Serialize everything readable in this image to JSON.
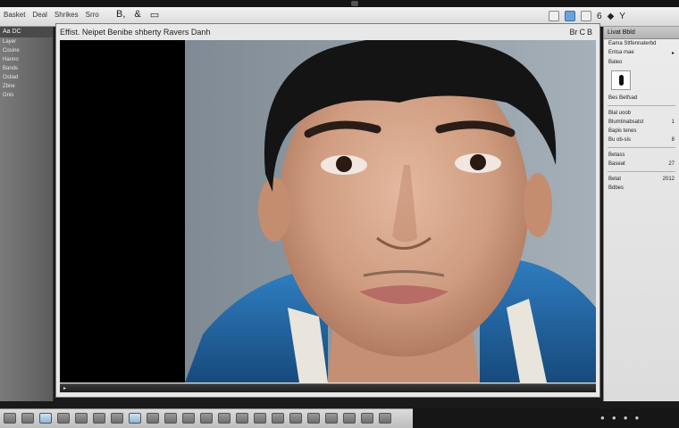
{
  "menu": {
    "items": [
      "Basket",
      "Deal",
      "Shrikes",
      "Srro"
    ]
  },
  "toolbar": {
    "glyphs": [
      "B,",
      "&",
      "▭"
    ],
    "right_glyphs": [
      "6",
      "◆",
      "Y"
    ]
  },
  "left_panel": {
    "header": "Aa DC",
    "items": [
      "Layer",
      "Cosine",
      "Hanno",
      "Bands",
      "Ostiad",
      "Zbne",
      "Gnis"
    ]
  },
  "document": {
    "title": "Effist. Neipet Benibe shberty Ravers Danh",
    "controls": [
      "Br",
      "C",
      "B"
    ],
    "status": "▸"
  },
  "right_panel": {
    "header": "Livat Bbld",
    "rows": [
      {
        "label": "Eama Sttfennaterbd",
        "value": ""
      },
      {
        "label": "Entsa mae",
        "value": "▸"
      },
      {
        "label": "Baleo",
        "value": ""
      },
      {
        "label": "Bes Betfsad",
        "value": ""
      },
      {
        "label": "Blal uoob",
        "value": ""
      },
      {
        "label": "Blumtinabsatst",
        "value": "1"
      },
      {
        "label": "Bapis tenes",
        "value": ""
      },
      {
        "label": "Bu ob-sis",
        "value": "8"
      },
      {
        "label": "Betass",
        "value": ""
      },
      {
        "label": "Baseat",
        "value": "27"
      },
      {
        "label": "Betat",
        "value": "2012"
      },
      {
        "label": "Bdbes",
        "value": ""
      }
    ]
  },
  "colors": {
    "accent": "#6aa3d8",
    "hoodie": "#1f5f9a",
    "background": "#8e9ba6"
  }
}
